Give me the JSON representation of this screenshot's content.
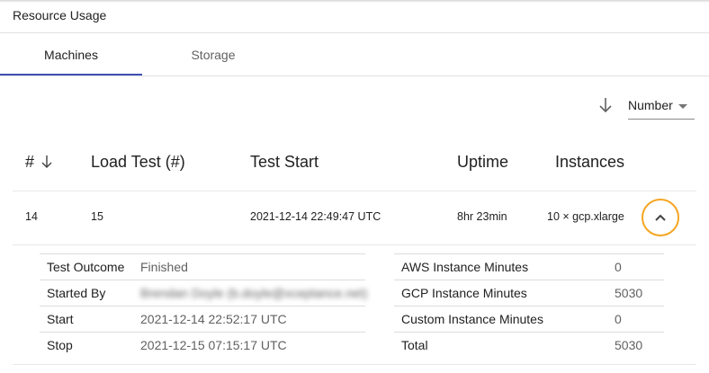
{
  "header": {
    "title": "Resource Usage"
  },
  "tabs": [
    {
      "label": "Machines",
      "active": true
    },
    {
      "label": "Storage",
      "active": false
    }
  ],
  "sort": {
    "selected": "Number",
    "direction_icon": "arrow-down-icon"
  },
  "table": {
    "columns": [
      "#",
      "Load Test (#)",
      "Test Start",
      "Uptime",
      "Instances"
    ],
    "row": {
      "number": "14",
      "load_test": "15",
      "test_start": "2021-12-14  22:49:47 UTC",
      "uptime": "8hr 23min",
      "instances": "10 × gcp.xlarge"
    }
  },
  "details": {
    "left": [
      {
        "label": "Test Outcome",
        "value": "Finished"
      },
      {
        "label": "Started By",
        "value": "Brendan Doyle (b.doyle@xceptance.net)"
      },
      {
        "label": "Start",
        "value": "2021-12-14  22:52:17 UTC"
      },
      {
        "label": "Stop",
        "value": "2021-12-15  07:15:17 UTC"
      }
    ],
    "right": [
      {
        "label": "AWS Instance Minutes",
        "value": "0"
      },
      {
        "label": "GCP Instance Minutes",
        "value": "5030"
      },
      {
        "label": "Custom Instance Minutes",
        "value": "0"
      },
      {
        "label": "Total",
        "value": "5030"
      }
    ]
  },
  "colors": {
    "accent": "#3f51b5",
    "highlight_ring": "#f5a623"
  }
}
